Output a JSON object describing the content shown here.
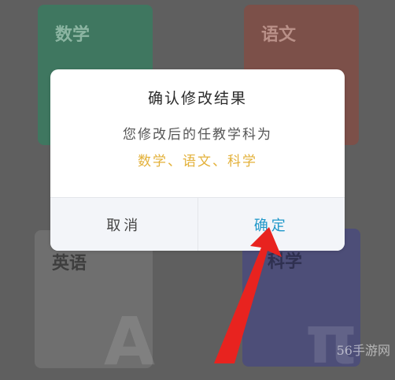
{
  "cards": {
    "math": {
      "title": "数学",
      "color": "#3f7760"
    },
    "chinese": {
      "title": "语文",
      "color": "#7c5049"
    },
    "english": {
      "title": "英语",
      "color": "#6f6f6f"
    },
    "science": {
      "title": "科学",
      "color": "#4d4e78"
    }
  },
  "dialog": {
    "title": "确认修改结果",
    "message": "您修改后的任教学科为",
    "subjects": "数学、语文、科学",
    "cancel_label": "取消",
    "confirm_label": "确定",
    "accent_color": "#1e97c9",
    "highlight_color": "#e3b13a"
  },
  "annotation": {
    "arrow_color": "#e8231f",
    "icon": "red-arrow-icon"
  },
  "watermark": "56手游网"
}
